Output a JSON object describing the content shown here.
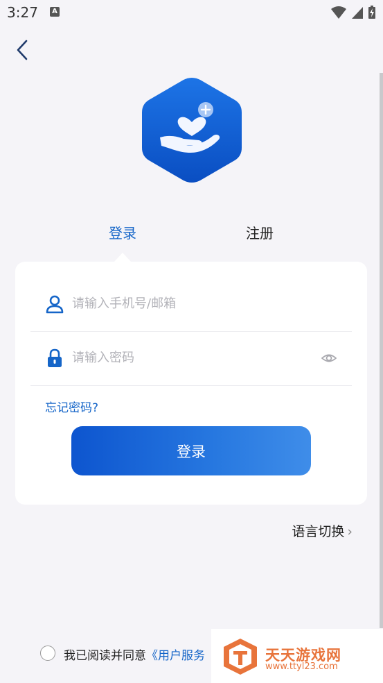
{
  "status": {
    "time": "3:27",
    "indicator": "A",
    "icons": [
      "wifi-icon",
      "signal-icon",
      "battery-charging-icon"
    ]
  },
  "nav": {
    "back_icon": "chevron-left-icon"
  },
  "logo": {
    "icon": "hand-heart-icon",
    "colors": {
      "start": "#1a6fe0",
      "end": "#0a4fc4"
    }
  },
  "tabs": [
    {
      "label": "登录",
      "active": true
    },
    {
      "label": "注册",
      "active": false
    }
  ],
  "form": {
    "phone": {
      "placeholder": "请输入手机号/邮箱",
      "value": "",
      "icon": "user-icon"
    },
    "password": {
      "placeholder": "请输入密码",
      "value": "",
      "icon": "lock-icon",
      "toggle_icon": "eye-icon"
    },
    "forgot_label": "忘记密码?",
    "submit_label": "登录"
  },
  "language": {
    "label": "语言切换",
    "chevron": "›"
  },
  "agreement": {
    "prefix": "我已阅读并同意",
    "link": "《用户服务"
  },
  "watermark": {
    "title": "天天游戏网",
    "url": "www.ttyl23.com"
  },
  "colors": {
    "accent": "#1565c8",
    "background": "#f5f4f8"
  }
}
